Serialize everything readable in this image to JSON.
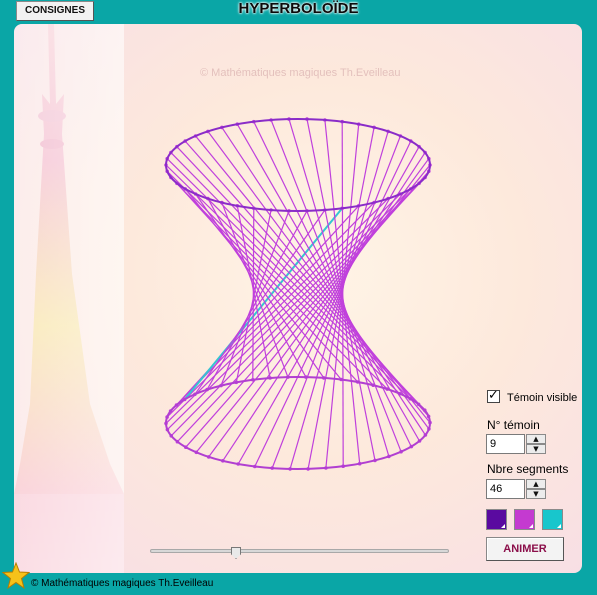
{
  "header": {
    "consignes_label": "CONSIGNES",
    "title": "HYPERBOLOÏDE"
  },
  "canvas": {
    "watermark": "© Mathématiques magiques Th.Eveilleau",
    "figure": {
      "type": "hyperboloid",
      "segments": 46,
      "witness_index": 9,
      "colors": {
        "top_circle": "#8a2cc8",
        "bottom_circle": "#b13fd1",
        "segments": "#c040dc",
        "witness": "#36c6d2"
      }
    }
  },
  "controls": {
    "witness_visible": {
      "label": "Témoin visible",
      "checked": true
    },
    "witness_number": {
      "label": "N° témoin",
      "value": "9"
    },
    "segment_count": {
      "label": "Nbre segments",
      "value": "46"
    },
    "swatches": [
      {
        "name": "violet",
        "color": "#5a0aa0"
      },
      {
        "name": "magenta",
        "color": "#c43ad0"
      },
      {
        "name": "cyan",
        "color": "#18c6cc"
      }
    ],
    "animate_label": "ANIMER",
    "slider": {
      "value": 0.3
    }
  },
  "footer": {
    "copyright": "© Mathématiques magiques Th.Eveilleau"
  },
  "theme": {
    "frame": "#0aa6a6"
  }
}
